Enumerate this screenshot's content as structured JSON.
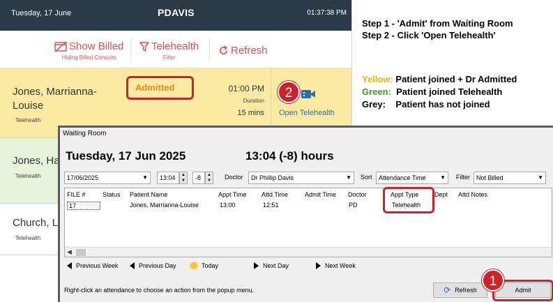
{
  "header": {
    "date": "Tuesday, 17 June",
    "user": "PDAVIS",
    "clock": "01:37:38 PM"
  },
  "toolbar": {
    "show_billed": {
      "label": "Show Billed",
      "sub": "Hiding Billed Consults"
    },
    "telehealth": {
      "label": "Telehealth",
      "sub": "Filter"
    },
    "refresh": {
      "label": "Refresh"
    }
  },
  "patients": [
    {
      "name_line1": "Jones, Marrianna-",
      "name_line2": "Louise",
      "type": "Telehealth",
      "status": "Admitted",
      "time": "01:00 PM",
      "duration_label": "Duration",
      "duration": "15 mins",
      "action": "Open Telehealth"
    },
    {
      "name": "Jones, Hap",
      "type": "Telehealth"
    },
    {
      "name": "Church, La",
      "type": "Telehealth"
    }
  ],
  "callouts": {
    "one": "1",
    "two": "2"
  },
  "instructions": {
    "step1": "Step 1 - 'Admit' from Waiting Room",
    "step2": "Step 2 - Click 'Open Telehealth'",
    "legend": [
      {
        "key": "Yellow:",
        "text": " Patient joined + Dr Admitted",
        "color": "#e8b800"
      },
      {
        "key": "Green:",
        "text": "  Patient joined Telehealth",
        "color": "#3a9a2a"
      },
      {
        "key": "Grey:",
        "text": "    Patient has not joined",
        "color": "#000000"
      }
    ]
  },
  "waiting_room": {
    "title": "Waiting Room",
    "big_date": "Tuesday, 17 Jun 2025",
    "big_time": "13:04 (-8)  hours",
    "date_field": "17/06/2025",
    "time_field": "13:04",
    "offset_field": "-8",
    "doctor_label": "Doctor",
    "doctor_value": "Dr Phillip Davis",
    "sort_label": "Sort",
    "sort_value": "Attendance Time",
    "filter_label": "Filter",
    "filter_value": "Not Billed",
    "columns": [
      "FILE #",
      "Status",
      "Patient Name",
      "Appt Time",
      "Attd Time",
      "Admit Time",
      "Doctor",
      "Appt Type",
      "Dept",
      "Attd Notes"
    ],
    "rows": [
      {
        "file": "17",
        "status": "",
        "patient": "Jones, Marrianna-Louise",
        "appt_time": "13:00",
        "attd_time": "12:51",
        "admit_time": "",
        "doctor": "PD",
        "appt_type": "Telehealth",
        "dept": "",
        "notes": ""
      }
    ],
    "nav": {
      "prev_week": "Previous Week",
      "prev_day": "Previous Day",
      "today": "Today",
      "next_day": "Next Day",
      "next_week": "Next Week"
    },
    "footer_text": "Right-click an attendance to choose an action from the popup menu.",
    "refresh_button": "Refresh",
    "admit_button": "Admit"
  },
  "colors": {
    "header_bg": "#2b3a47",
    "accent_red": "#cc2229",
    "toolbar_red": "#d9534f",
    "yellow_row": "#fbeba2",
    "green_row": "#e6f4d9",
    "link_blue": "#2a6ebb"
  }
}
